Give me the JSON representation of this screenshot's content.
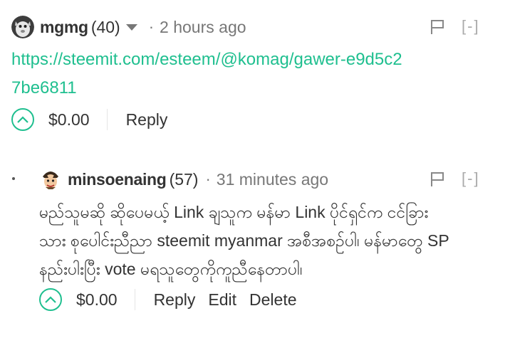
{
  "comments": [
    {
      "author": "mgmg",
      "reputation": "(40)",
      "separator": "·",
      "time": "2 hours ago",
      "body_link": "https://steemit.com/esteem/@komag/gawer-e9d5c27be6811",
      "payout": "$0.00",
      "actions": [
        "Reply"
      ],
      "collapse": "[-]"
    },
    {
      "author": "minsoenaing",
      "reputation": "(57)",
      "separator": "·",
      "time": "31 minutes ago",
      "body_lines": [
        "မည်သူမဆို ဆိုပေမယ့် Link ချသူက  မန်မာ Link ပိုင်ရှင်က     ငင်ခြား",
        "သား စုပေါင်းညီညာ steemit myanmar အစီအစဉ်ပါ၊  မန်မာတွေ SP",
        "နည်းပါးပြီး vote မရသူတွေကိုကူညီနေတာပါ၊"
      ],
      "payout": "$0.00",
      "actions": [
        "Reply",
        "Edit",
        "Delete"
      ],
      "collapse": "[-]"
    }
  ],
  "icons": {
    "caret": "caret-down-icon",
    "flag": "flag-icon",
    "upvote": "upvote-chevron-icon"
  },
  "colors": {
    "accent": "#1fbf8f",
    "text": "#333333",
    "muted": "#777777"
  }
}
